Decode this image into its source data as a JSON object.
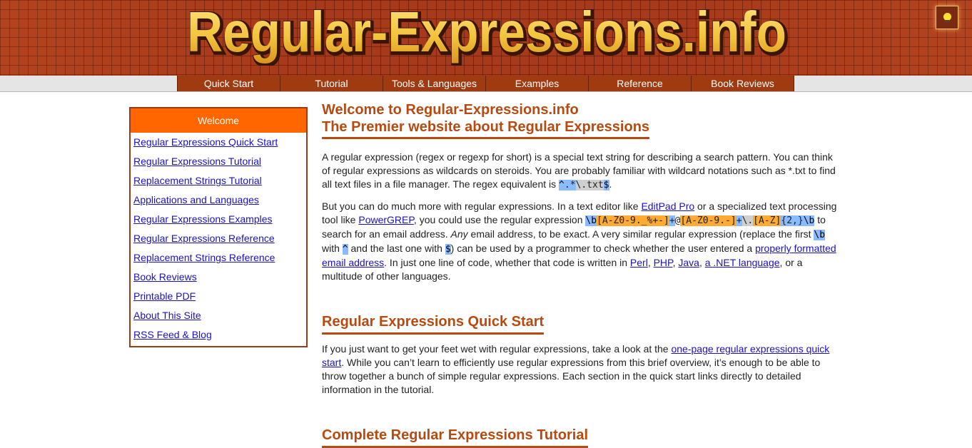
{
  "site_title": "Regular-Expressions.info",
  "nav": [
    "Quick Start",
    "Tutorial",
    "Tools & Languages",
    "Examples",
    "Reference",
    "Book Reviews"
  ],
  "sidebar": {
    "heading": "Welcome",
    "links": [
      "Regular Expressions Quick Start",
      "Regular Expressions Tutorial",
      "Replacement Strings Tutorial",
      "Applications and Languages",
      "Regular Expressions Examples",
      "Regular Expressions Reference",
      "Replacement Strings Reference",
      "Book Reviews",
      "Printable PDF",
      "About This Site",
      "RSS Feed & Blog"
    ]
  },
  "main": {
    "title_line1": "Welcome to Regular-Expressions.info",
    "title_line2": "The Premier website about Regular Expressions",
    "p1": {
      "text": "A regular expression (regex or regexp for short) is a special text string for describing a search pattern. You can think of regular expressions as wildcards on steroids. You are probably familiar with wildcard notations such as *.txt to find all text files in a file manager. The regex equivalent is ",
      "regex_caret": "^",
      "regex_dotstar": ".*",
      "regex_lit": "\\.txt",
      "regex_dollar": "$",
      "end": "."
    },
    "p2": {
      "t1": "But you can do much more with regular expressions. In a text editor like ",
      "link_editpad": "EditPad Pro",
      "t2": " or a specialized text processing tool like ",
      "link_powergrep": "PowerGREP",
      "t3": ", you could use the regular expression ",
      "rx": {
        "b1": "\\b",
        "c1": "[A-Z0-9._%+-]",
        "q1": "+",
        "at": "@",
        "c2": "[A-Z0-9.-]",
        "q2": "+",
        "dot": "\\.",
        "c3": "[A-Z]",
        "q3": "{2,}",
        "b2": "\\b"
      },
      "t4": " to search for an email address. ",
      "em": "Any",
      "t5": " email address, to be exact. A very similar regular expression (replace the first ",
      "rx_b": "\\b",
      "t6": " with ",
      "rx_caret": "^",
      "t7": " and the last one with ",
      "rx_dollar": "$",
      "t8": ") can be used by a programmer to check whether the user entered a ",
      "link_email": "properly formatted email address",
      "t9": ". In just one line of code, whether that code is written in ",
      "link_perl": "Perl",
      "c_a": ", ",
      "link_php": "PHP",
      "c_b": ", ",
      "link_java": "Java",
      "c_c": ", ",
      "link_net": "a .NET language",
      "t10": ", or a multitude of other languages."
    },
    "quickstart_heading": "Regular Expressions Quick Start",
    "p3": {
      "t1": "If you just want to get your feet wet with regular expressions, take a look at the ",
      "link": "one-page regular expressions quick start",
      "t2": ". While you can’t learn to efficiently use regular expressions from this brief overview, it’s enough to be able to throw together a bunch of simple regular expressions. Each section in the quick start links directly to detailed information in the tutorial."
    },
    "tutorial_heading": "Complete Regular Expressions Tutorial"
  },
  "colors": {
    "accent": "#b84a10",
    "sidebar_head": "#ff6600",
    "nav_bg": "#a03a10",
    "link": "#1a12c8"
  },
  "icons": {
    "theme_toggle": "lightbulb-icon"
  }
}
